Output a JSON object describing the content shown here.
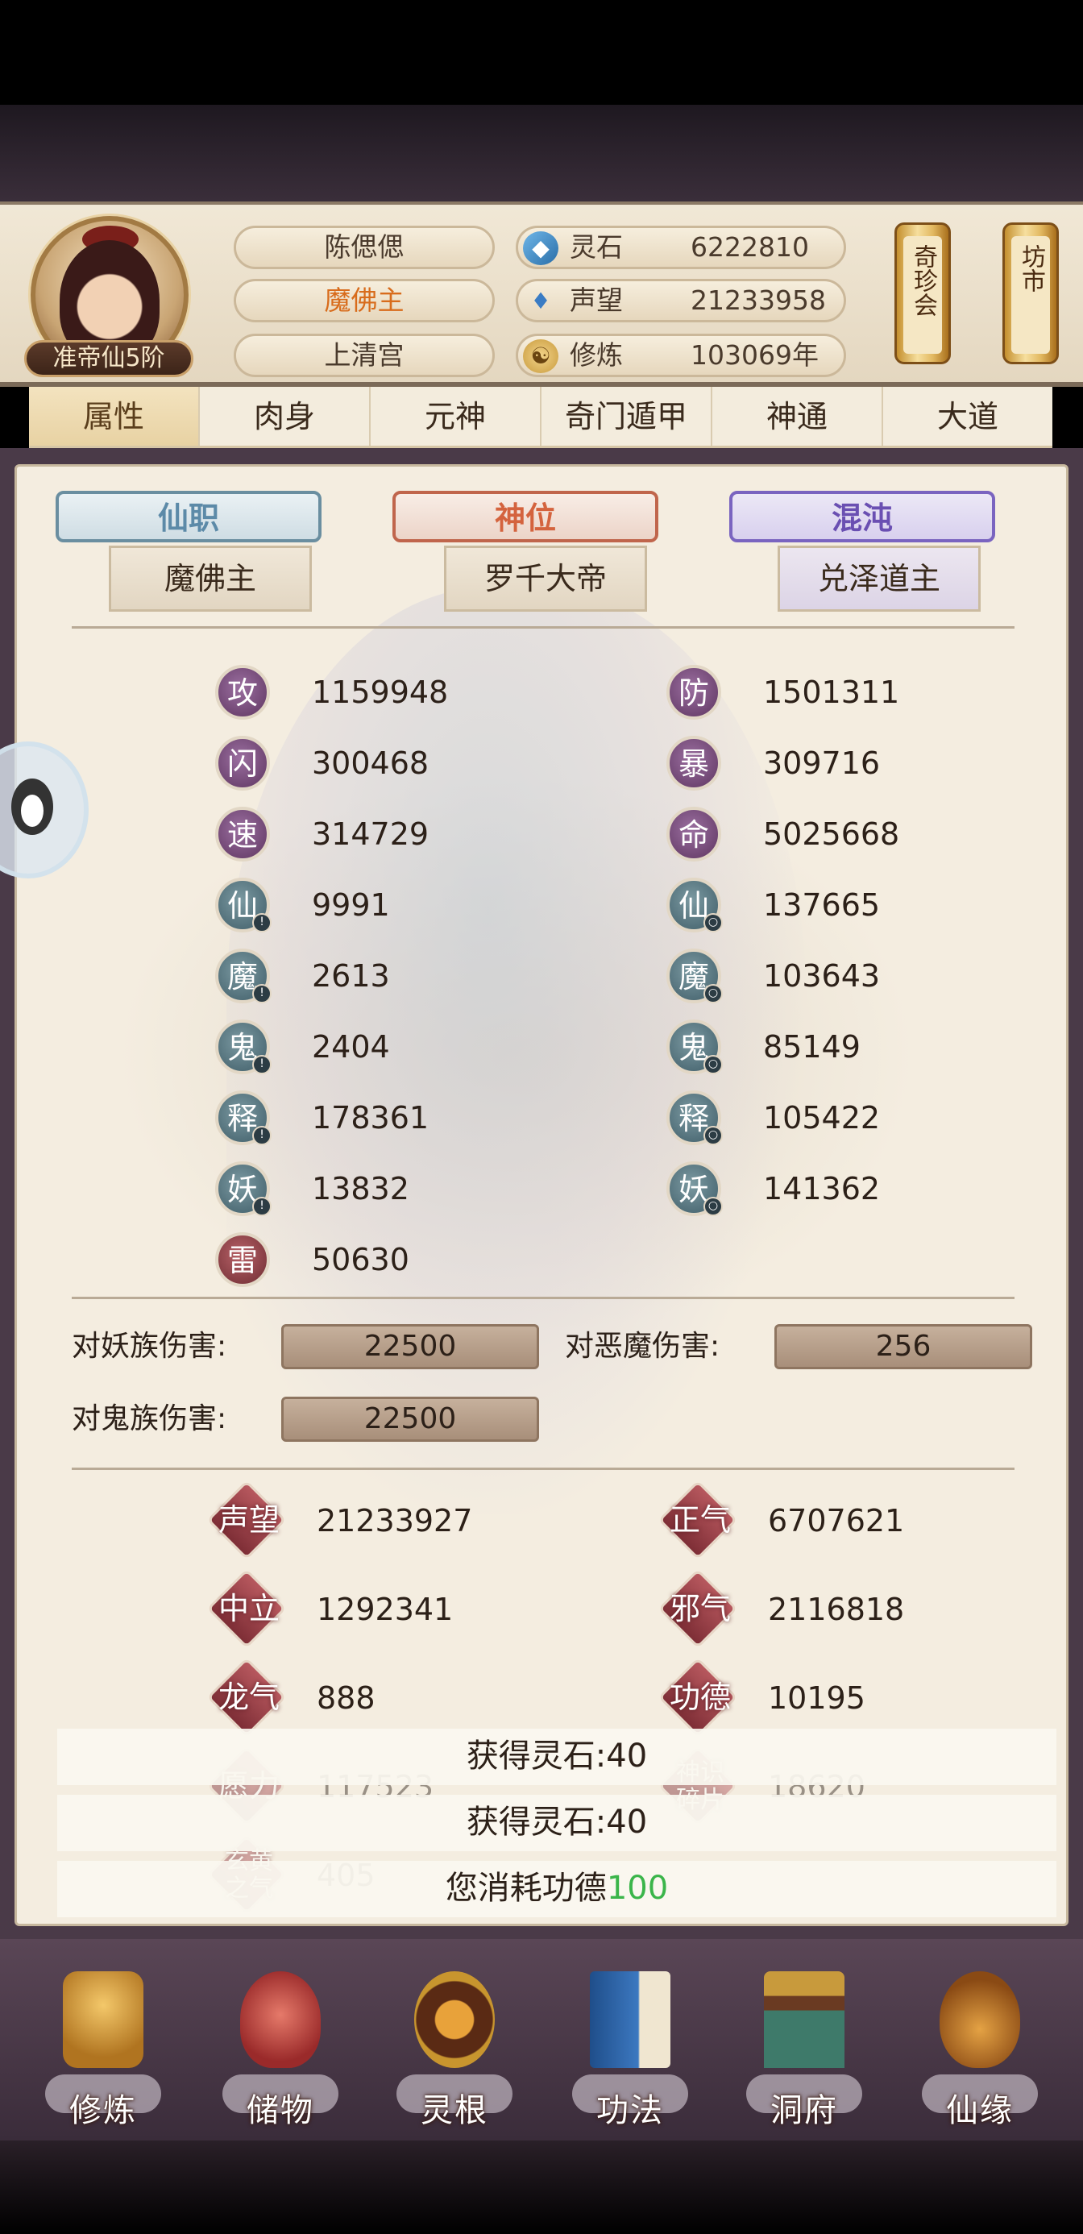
{
  "player": {
    "name": "陈偲偲",
    "title": "魔佛主",
    "sect": "上清宫",
    "realm": "准帝仙5阶"
  },
  "resources": [
    {
      "icon": "spirit-stone-icon",
      "label": "灵石",
      "value": "6222810"
    },
    {
      "icon": "reputation-icon",
      "label": "声望",
      "value": "21233958"
    },
    {
      "icon": "cultivation-icon",
      "label": "修炼",
      "value": "103069年"
    }
  ],
  "side_buttons": {
    "treasure_fair": "奇珍会",
    "market": "坊市"
  },
  "tabs": [
    "属性",
    "肉身",
    "元神",
    "奇门遁甲",
    "神通",
    "大道"
  ],
  "active_tab": "属性",
  "ranks": {
    "post": {
      "label": "仙职",
      "value": "魔佛主"
    },
    "divine": {
      "label": "神位",
      "value": "罗千大帝"
    },
    "chaos": {
      "label": "混沌",
      "value": "兑泽道主"
    }
  },
  "stats_left": [
    {
      "glyph": "攻",
      "value": "1159948"
    },
    {
      "glyph": "闪",
      "value": "300468"
    },
    {
      "glyph": "速",
      "value": "314729"
    },
    {
      "glyph": "仙",
      "value": "9991"
    },
    {
      "glyph": "魔",
      "value": "2613"
    },
    {
      "glyph": "鬼",
      "value": "2404"
    },
    {
      "glyph": "释",
      "value": "178361"
    },
    {
      "glyph": "妖",
      "value": "13832"
    },
    {
      "glyph": "雷",
      "value": "50630"
    }
  ],
  "stats_right": [
    {
      "glyph": "防",
      "value": "1501311"
    },
    {
      "glyph": "暴",
      "value": "309716"
    },
    {
      "glyph": "命",
      "value": "5025668"
    },
    {
      "glyph": "仙",
      "value": "137665"
    },
    {
      "glyph": "魔",
      "value": "103643"
    },
    {
      "glyph": "鬼",
      "value": "85149"
    },
    {
      "glyph": "释",
      "value": "105422"
    },
    {
      "glyph": "妖",
      "value": "141362"
    }
  ],
  "damage": {
    "yao_label": "对妖族伤害:",
    "yao_value": "22500",
    "demon_label": "对恶魔伤害:",
    "demon_value": "256",
    "ghost_label": "对鬼族伤害:",
    "ghost_value": "22500"
  },
  "reputation": [
    {
      "label": "声望",
      "value": "21233927"
    },
    {
      "label": "正气",
      "value": "6707621"
    },
    {
      "label": "中立",
      "value": "1292341"
    },
    {
      "label": "邪气",
      "value": "2116818"
    },
    {
      "label": "龙气",
      "value": "888"
    },
    {
      "label": "功德",
      "value": "10195"
    },
    {
      "label": "愿力",
      "value": "117523"
    },
    {
      "label": "神识碎片",
      "value": "18620"
    },
    {
      "label": "玄黄之气",
      "value": "405"
    }
  ],
  "toasts": [
    {
      "text": "获得灵石:40"
    },
    {
      "text": "获得灵石:40"
    },
    {
      "prefix": "您消耗功德",
      "amount": "100"
    }
  ],
  "bottom_nav": [
    {
      "label": "修炼",
      "icon": "cultivate-icon"
    },
    {
      "label": "储物",
      "icon": "storage-bag-icon"
    },
    {
      "label": "灵根",
      "icon": "spirit-root-icon"
    },
    {
      "label": "功法",
      "icon": "technique-book-icon"
    },
    {
      "label": "洞府",
      "icon": "cave-abode-icon"
    },
    {
      "label": "仙缘",
      "icon": "immortal-fate-icon"
    }
  ],
  "colors": {
    "accent_orange": "#d86c1c",
    "merit_green": "#3ab54a",
    "badge_purple": "#7a4a7e",
    "badge_teal": "#56747e",
    "badge_red": "#8e3a40"
  }
}
